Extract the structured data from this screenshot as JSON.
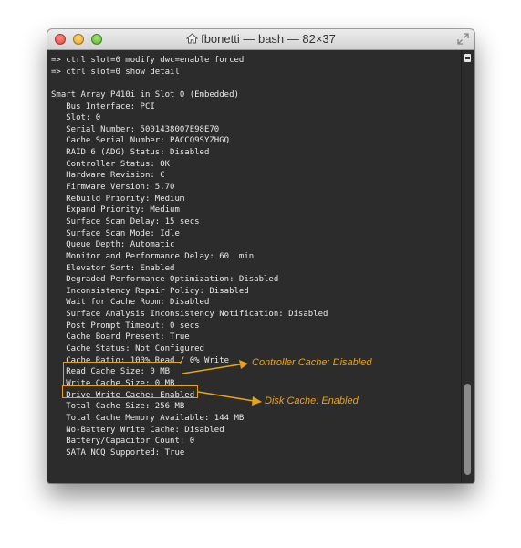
{
  "window": {
    "title": "fbonetti — bash — 82×37"
  },
  "terminal": {
    "lines": [
      "=> ctrl slot=0 modify dwc=enable forced",
      "=> ctrl slot=0 show detail",
      "",
      "Smart Array P410i in Slot 0 (Embedded)",
      "   Bus Interface: PCI",
      "   Slot: 0",
      "   Serial Number: 5001438007E98E70",
      "   Cache Serial Number: PACCQ9SYZHGQ",
      "   RAID 6 (ADG) Status: Disabled",
      "   Controller Status: OK",
      "   Hardware Revision: C",
      "   Firmware Version: 5.70",
      "   Rebuild Priority: Medium",
      "   Expand Priority: Medium",
      "   Surface Scan Delay: 15 secs",
      "   Surface Scan Mode: Idle",
      "   Queue Depth: Automatic",
      "   Monitor and Performance Delay: 60  min",
      "   Elevator Sort: Enabled",
      "   Degraded Performance Optimization: Disabled",
      "   Inconsistency Repair Policy: Disabled",
      "   Wait for Cache Room: Disabled",
      "   Surface Analysis Inconsistency Notification: Disabled",
      "   Post Prompt Timeout: 0 secs",
      "   Cache Board Present: True",
      "   Cache Status: Not Configured",
      "   Cache Ratio: 100% Read / 0% Write",
      "   Read Cache Size: 0 MB",
      "   Write Cache Size: 0 MB",
      "   Drive Write Cache: Enabled",
      "   Total Cache Size: 256 MB",
      "   Total Cache Memory Available: 144 MB",
      "   No-Battery Write Cache: Disabled",
      "   Battery/Capacitor Count: 0",
      "   SATA NCQ Supported: True",
      "",
      "",
      "=>"
    ]
  },
  "annotations": {
    "controller_cache": "Controller Cache: Disabled",
    "disk_cache": "Disk Cache: Enabled",
    "color": "#e8a21a"
  },
  "icons": {
    "close": "close-icon",
    "minimize": "minimize-icon",
    "zoom": "zoom-icon",
    "home": "home-icon",
    "fullscreen": "fullscreen-icon"
  }
}
